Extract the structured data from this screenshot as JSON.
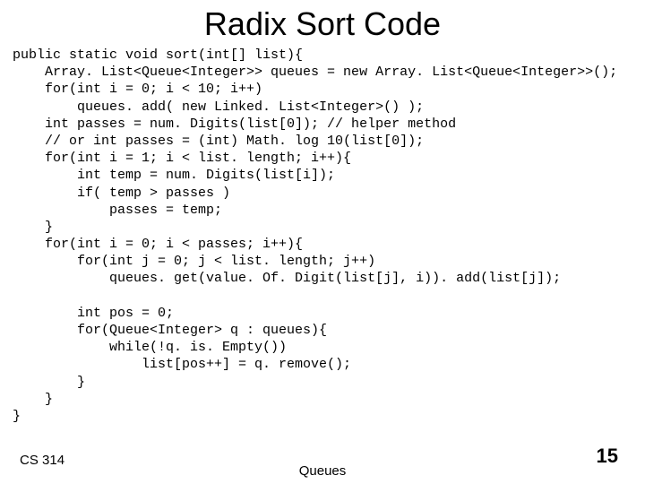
{
  "title": "Radix Sort Code",
  "code": "public static void sort(int[] list){\n    Array. List<Queue<Integer>> queues = new Array. List<Queue<Integer>>();\n    for(int i = 0; i < 10; i++)\n        queues. add( new Linked. List<Integer>() );\n    int passes = num. Digits(list[0]); // helper method\n    // or int passes = (int) Math. log 10(list[0]);\n    for(int i = 1; i < list. length; i++){\n        int temp = num. Digits(list[i]);\n        if( temp > passes )\n            passes = temp;\n    }\n    for(int i = 0; i < passes; i++){\n        for(int j = 0; j < list. length; j++)\n            queues. get(value. Of. Digit(list[j], i)). add(list[j]);\n\n        int pos = 0;\n        for(Queue<Integer> q : queues){\n            while(!q. is. Empty())\n                list[pos++] = q. remove();\n        }\n    }\n}",
  "footer": {
    "left": "CS 314",
    "center": "Queues",
    "right": "15"
  }
}
